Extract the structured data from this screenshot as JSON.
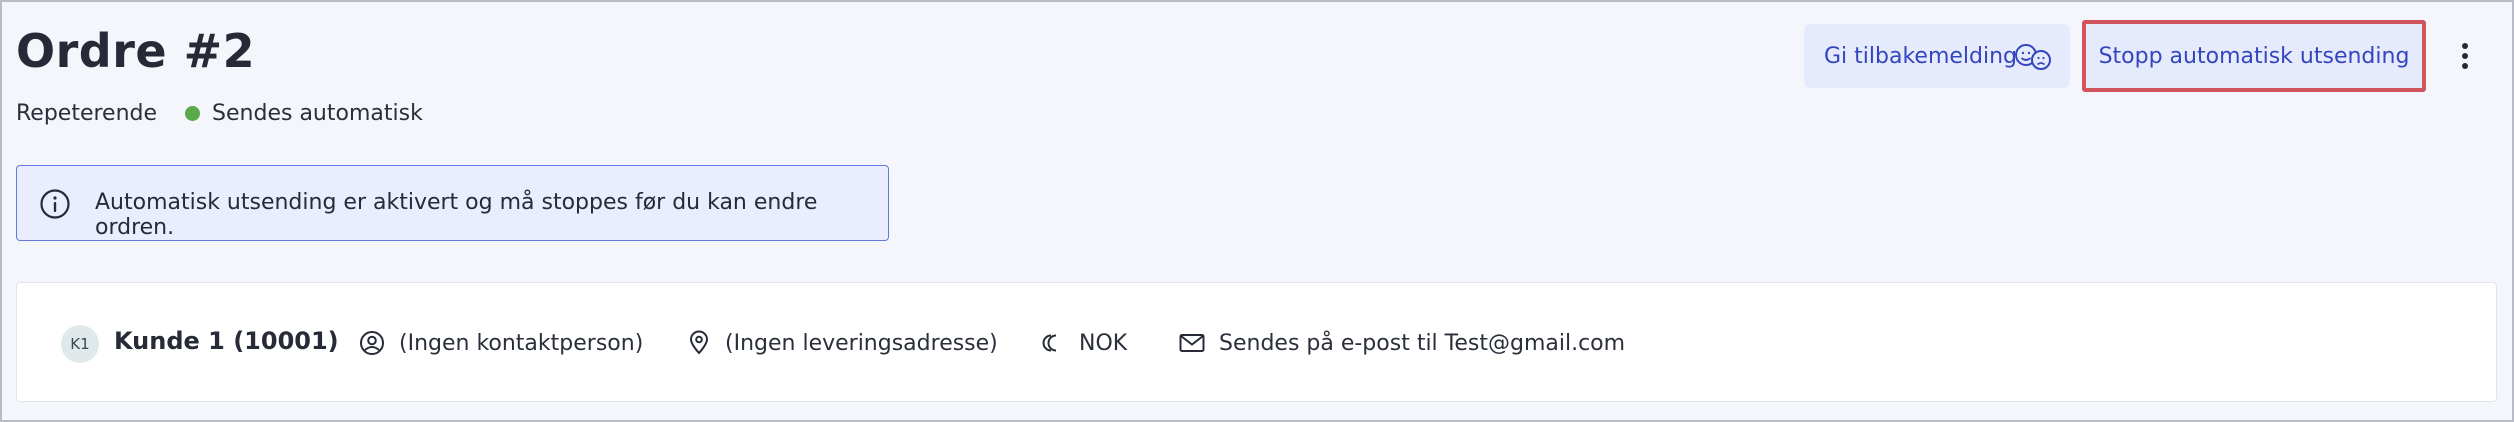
{
  "order": {
    "title": "Ordre #2",
    "type_label": "Repeterende",
    "status_label": "Sendes automatisk",
    "status_color": "#5aaa4c"
  },
  "actions": {
    "feedback_label": "Gi tilbakemelding",
    "stop_label": "Stopp automatisk utsending",
    "more_icon": "more-vertical-icon"
  },
  "notice": {
    "icon": "info-icon",
    "text": "Automatisk utsending er aktivert og må stoppes før du kan endre ordren."
  },
  "customer": {
    "avatar_initials": "K1",
    "name": "Kunde 1 (10001)",
    "contact": "(Ingen kontaktperson)",
    "delivery_address": "(Ingen leveringsadresse)",
    "currency": "NOK",
    "delivery_method": "Sendes på e-post til Test@gmail.com"
  },
  "colors": {
    "accent": "#3346bd",
    "highlight_border": "#d2545f",
    "button_bg": "#e6eafd"
  }
}
